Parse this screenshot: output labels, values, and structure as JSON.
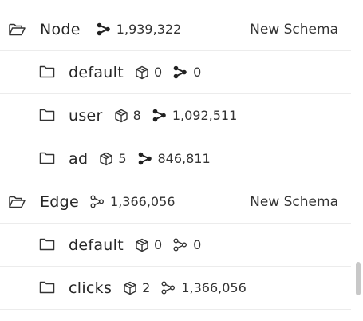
{
  "tree": {
    "node": {
      "label": "Node",
      "edge_count": "1,939,322",
      "schema_label": "New Schema",
      "children": [
        {
          "label": "default",
          "vertex_count": "0",
          "edge_count": "0"
        },
        {
          "label": "user",
          "vertex_count": "8",
          "edge_count": "1,092,511"
        },
        {
          "label": "ad",
          "vertex_count": "5",
          "edge_count": "846,811"
        }
      ]
    },
    "edge": {
      "label": "Edge",
      "edge_count": "1,366,056",
      "schema_label": "New Schema",
      "children": [
        {
          "label": "default",
          "vertex_count": "0",
          "edge_count": "0"
        },
        {
          "label": "clicks",
          "vertex_count": "2",
          "edge_count": "1,366,056"
        }
      ]
    }
  },
  "icons": {
    "folder_open": "folder-open-icon",
    "folder": "folder-icon",
    "cube": "cube-icon",
    "edge_filled": "edge-filled-icon",
    "edge_outline": "edge-outline-icon"
  }
}
